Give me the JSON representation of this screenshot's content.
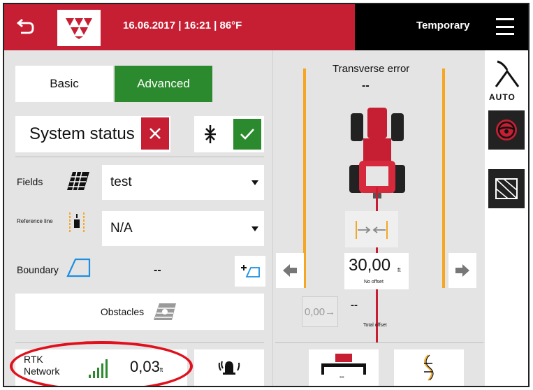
{
  "header": {
    "datetime": "16.06.2017 | 16:21 | 86°F",
    "mode": "Temporary"
  },
  "tabs": {
    "basic": "Basic",
    "advanced": "Advanced"
  },
  "system_status": {
    "label": "System status"
  },
  "fields": {
    "label": "Fields",
    "value": "test"
  },
  "reference_line": {
    "label": "Reference line",
    "value": "N/A"
  },
  "boundary": {
    "label": "Boundary",
    "value": "--"
  },
  "obstacles": {
    "label": "Obstacles"
  },
  "rtk": {
    "label_line1": "RTK",
    "label_line2": "Network",
    "value": "0,03",
    "unit": "ft"
  },
  "guidance": {
    "title": "Transverse error",
    "transverse_value": "--",
    "offset_value": "30,00",
    "offset_unit": "ft",
    "offset_label": "No offset",
    "total_offset_button": "0,00→",
    "total_offset_value": "--",
    "total_offset_label": "Total offset",
    "implement_value": "--"
  },
  "toolbar": {
    "auto_label": "AUTO"
  },
  "colors": {
    "brand_red": "#c61f33",
    "active_green": "#2b8a2e",
    "guide_orange": "#f5a623"
  },
  "icons": [
    "back-icon",
    "brand-logo",
    "menu-icon",
    "close-icon",
    "checkmark-icon",
    "field-icon",
    "reference-line-icon",
    "boundary-icon",
    "add-boundary-icon",
    "obstacles-icon",
    "signal-bars-icon",
    "alarm-icon",
    "tractor-icon",
    "steer-left-icon",
    "steer-right-icon",
    "auto-steer-icon",
    "steering-wheel-icon",
    "map-icon"
  ]
}
